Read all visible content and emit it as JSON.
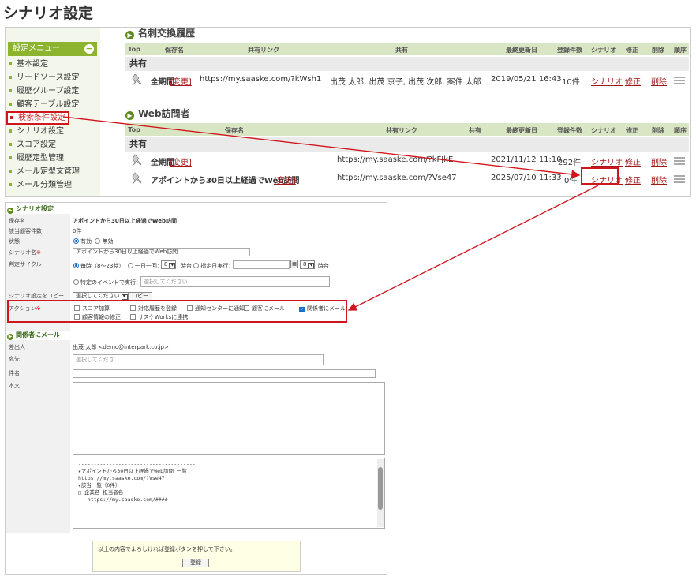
{
  "page_title": "シナリオ設定",
  "sidebar": {
    "header": "設定メニュー",
    "toggle": "−",
    "items": [
      {
        "label": "基本設定"
      },
      {
        "label": "リードソース設定"
      },
      {
        "label": "履歴グループ設定"
      },
      {
        "label": "顧客テーブル設定"
      },
      {
        "label": "検索条件設定",
        "active": true
      },
      {
        "label": "シナリオ設定"
      },
      {
        "label": "スコア設定"
      },
      {
        "label": "履歴定型管理"
      },
      {
        "label": "メール定型文管理"
      },
      {
        "label": "メール分類管理"
      }
    ]
  },
  "card_history": {
    "title": "名刺交換履歴",
    "columns": [
      "Top",
      "保存名",
      "共有リンク",
      "共有",
      "最終更新日",
      "登録件数",
      "シナリオ",
      "修正",
      "削除",
      "順序"
    ],
    "group": "共有",
    "rows": [
      {
        "name": "全期間",
        "change": "[変更]",
        "link": "https://my.saaske.com/?kWsh1",
        "shared": "出茂 太郎, 出茂 京子, 出茂 次郎, 案件 太郎",
        "updated": "2019/05/21 16:43",
        "count": "10件",
        "scenario": "シナリオ",
        "edit": "修正",
        "delete": "削除"
      }
    ]
  },
  "web_visitors": {
    "title": "Web訪問者",
    "columns": [
      "Top",
      "保存名",
      "共有リンク",
      "共有",
      "最終更新日",
      "登録件数",
      "シナリオ",
      "修正",
      "削除",
      "順序"
    ],
    "group": "共有",
    "rows": [
      {
        "name": "全期間",
        "change": "[変更]",
        "link": "https://my.saaske.com/?kFJkE",
        "updated": "2021/11/12 11:10",
        "count": "292件",
        "scenario": "シナリオ",
        "edit": "修正",
        "delete": "削除"
      },
      {
        "name": "アポイントから30日以上経過でWeb訪問",
        "change": "[変更]",
        "link": "https://my.saaske.com/?Vse47",
        "updated": "2025/07/10 11:33",
        "count": "0件",
        "scenario": "シナリオ",
        "edit": "修正",
        "delete": "削除"
      }
    ]
  },
  "scenario_form": {
    "title": "シナリオ設定",
    "save_name_label": "保存名",
    "save_name_value": "アポイントから30日以上経過でWeb訪問",
    "matching_count_label": "該当顧客件数",
    "matching_count_value": "0件",
    "status_label": "状態",
    "status_options": [
      "有効",
      "無効"
    ],
    "scenario_name_label": "シナリオ名",
    "scenario_name_value": "アポイントから30日以上経過でWeb訪問",
    "cycle_label": "判定サイクル",
    "cycle_hourly": "毎時（8〜23時）",
    "cycle_daily": "一日一回：",
    "cycle_daily_hour": "8",
    "cycle_daily_suffix": "時台",
    "cycle_specified": "指定日実行：",
    "cycle_specified_hour": "8",
    "cycle_specified_suffix": "時台",
    "cycle_event": "特定のイベントで実行：",
    "cycle_event_placeholder": "選択してください",
    "copy_label": "シナリオ設定をコピー",
    "copy_select": "選択してください",
    "copy_button": "コピー",
    "action_label": "アクション",
    "actions": [
      {
        "label": "スコア加算",
        "checked": false
      },
      {
        "label": "対応履歴を登録",
        "checked": false
      },
      {
        "label": "通知センターに通知",
        "checked": false
      },
      {
        "label": "顧客にメール",
        "checked": false
      },
      {
        "label": "関係者にメール",
        "checked": true
      },
      {
        "label": "顧客情報の修正",
        "checked": false
      },
      {
        "label": "サスケWorksに連携",
        "checked": false
      }
    ]
  },
  "mail_form": {
    "title": "関係者にメール",
    "from_label": "差出人",
    "from_value": "出茂 太郎 <demo@interpark.co.jp>",
    "to_label": "宛先",
    "to_placeholder": "選択してくださ",
    "subject_label": "件名",
    "body_label": "本文",
    "preview_lines": [
      "--------------------------------------",
      "★アポイントから30日以上経過でWeb訪問 一覧",
      "https://my.saaske.com/?Vse47",
      "",
      "★該当一覧（0件）",
      "",
      "□ 企業名 担当者名",
      "   https://my.saaske.com/####",
      "     .",
      "     ."
    ]
  },
  "footer": {
    "notice": "以上の内容でよろしければ登録ボタンを押して下さい。",
    "submit": "登録"
  },
  "required_mark": "※",
  "colors": {
    "accent_green": "#8cb42e",
    "highlight_red": "#d0161d",
    "link_red": "#a01818"
  }
}
